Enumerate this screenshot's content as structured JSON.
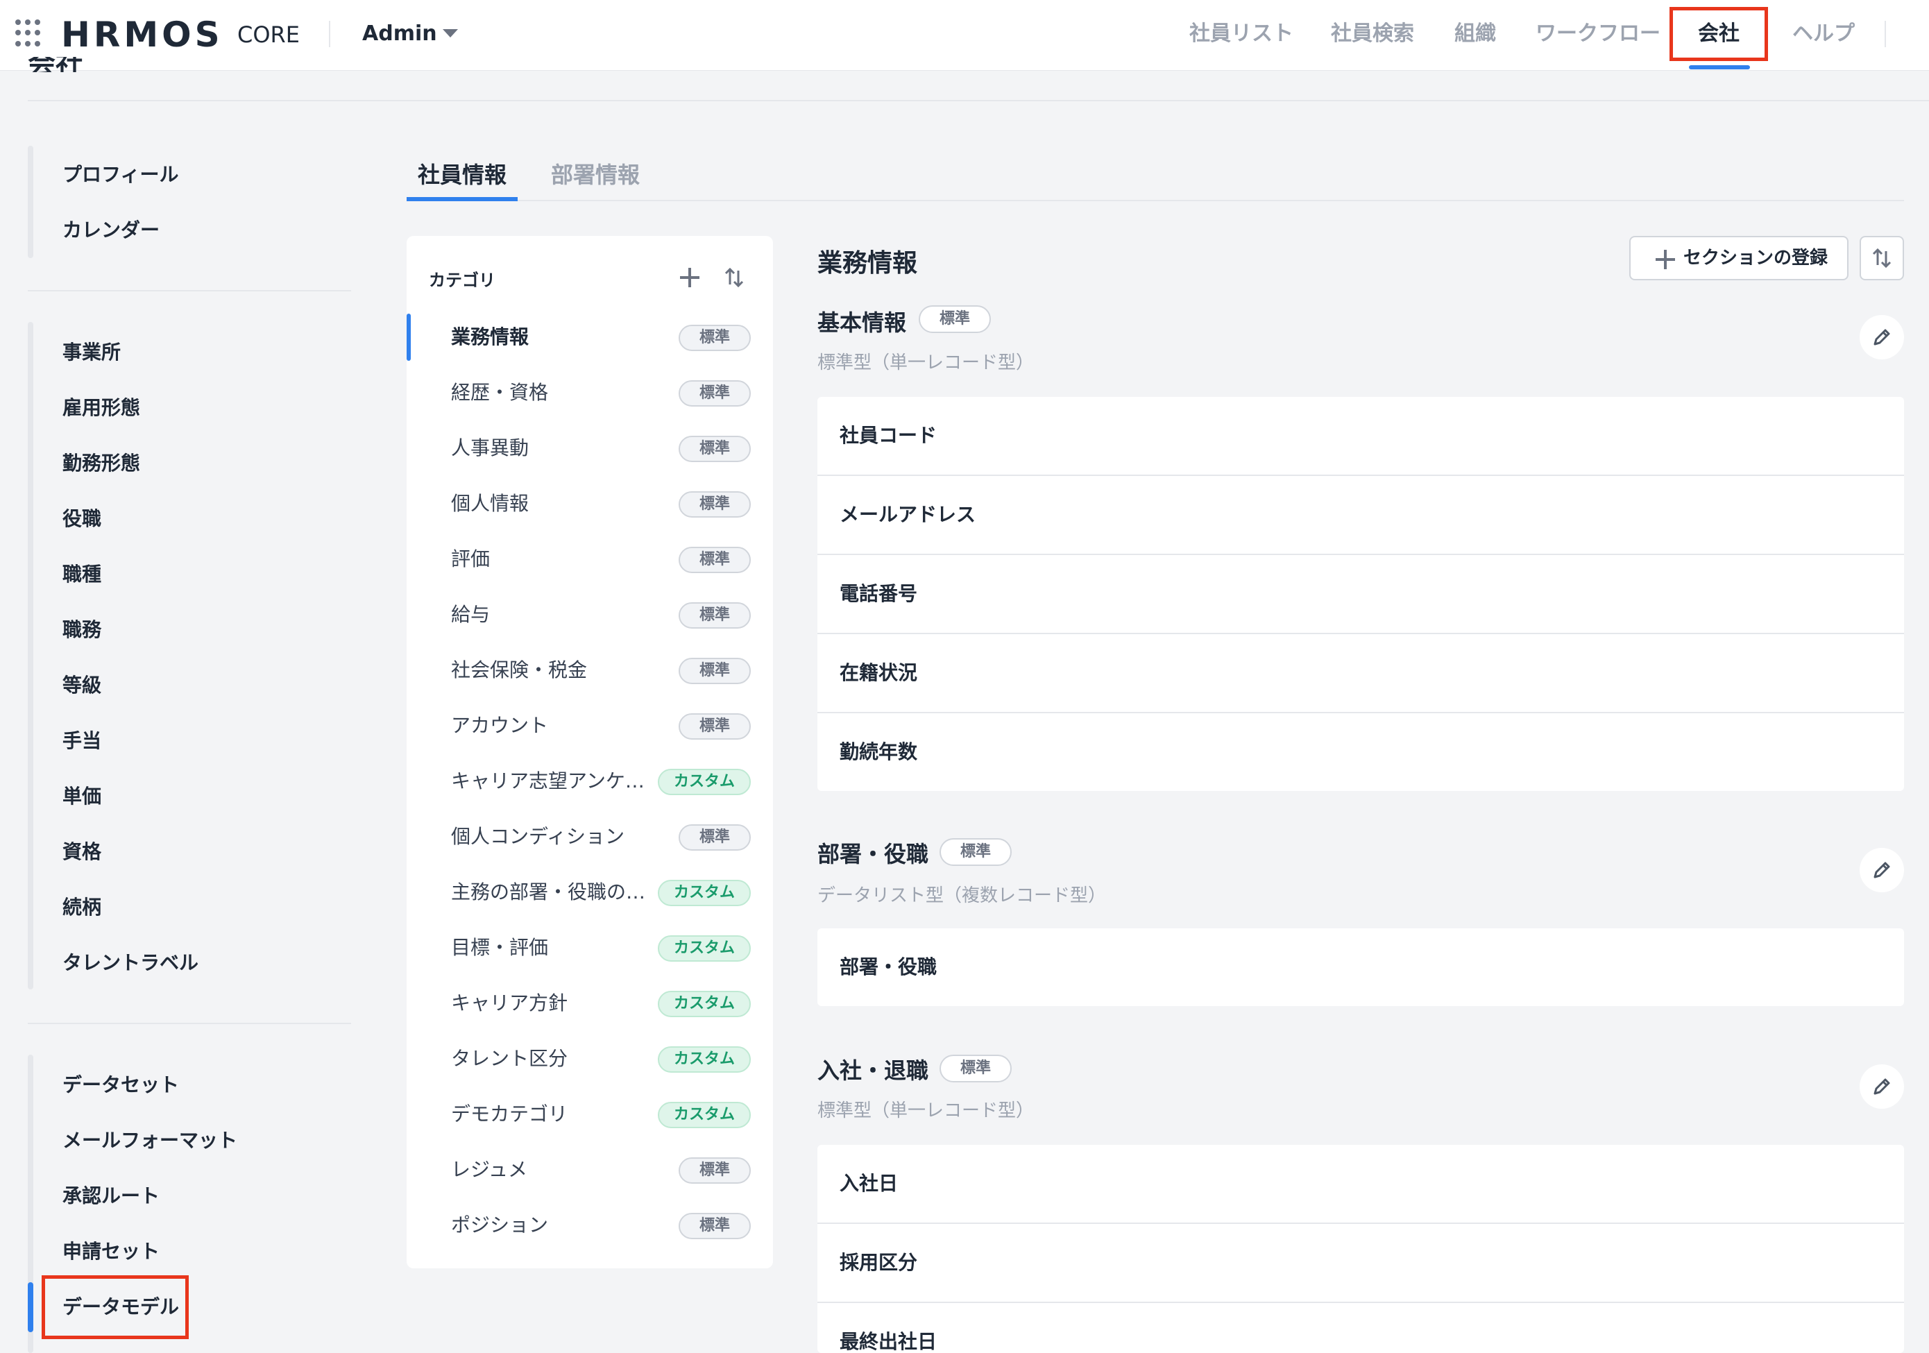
{
  "header": {
    "brand": "HRMOS",
    "brand_sub": "CORE",
    "account": "Admin",
    "nav": [
      "社員リスト",
      "社員検索",
      "組織",
      "ワークフロー",
      "会社",
      "ヘルプ"
    ],
    "active_nav": "会社"
  },
  "page": {
    "title": "会社"
  },
  "sidebar": {
    "group1": [
      "プロフィール",
      "カレンダー"
    ],
    "group2": [
      "事業所",
      "雇用形態",
      "勤務形態",
      "役職",
      "職種",
      "職務",
      "等級",
      "手当",
      "単価",
      "資格",
      "続柄",
      "タレントラベル"
    ],
    "group3": [
      "データセット",
      "メールフォーマット",
      "承認ルート",
      "申請セット",
      "データモデル"
    ],
    "active": "データモデル"
  },
  "tabs": [
    "社員情報",
    "部署情報"
  ],
  "categories": {
    "header": "カテゴリ",
    "items": [
      {
        "label": "業務情報",
        "badge": "標準"
      },
      {
        "label": "経歴・資格",
        "badge": "標準"
      },
      {
        "label": "人事異動",
        "badge": "標準"
      },
      {
        "label": "個人情報",
        "badge": "標準"
      },
      {
        "label": "評価",
        "badge": "標準"
      },
      {
        "label": "給与",
        "badge": "標準"
      },
      {
        "label": "社会保険・税金",
        "badge": "標準"
      },
      {
        "label": "アカウント",
        "badge": "標準"
      },
      {
        "label": "キャリア志望アンケート",
        "badge": "カスタム"
      },
      {
        "label": "個人コンディション",
        "badge": "標準"
      },
      {
        "label": "主務の部署・役職の履歴",
        "badge": "カスタム"
      },
      {
        "label": "目標・評価",
        "badge": "カスタム"
      },
      {
        "label": "キャリア方針",
        "badge": "カスタム"
      },
      {
        "label": "タレント区分",
        "badge": "カスタム"
      },
      {
        "label": "デモカテゴリ",
        "badge": "カスタム"
      },
      {
        "label": "レジュメ",
        "badge": "標準"
      },
      {
        "label": "ポジション",
        "badge": "標準"
      }
    ]
  },
  "detail": {
    "title": "業務情報",
    "add_section_label": "セクションの登録",
    "sections": [
      {
        "title": "基本情報",
        "badge": "標準",
        "type": "標準型（単一レコード型）",
        "fields": [
          "社員コード",
          "メールアドレス",
          "電話番号",
          "在籍状況",
          "勤続年数"
        ]
      },
      {
        "title": "部署・役職",
        "badge": "標準",
        "type": "データリスト型（複数レコード型）",
        "fields": [
          "部署・役職"
        ]
      },
      {
        "title": "入社・退職",
        "badge": "標準",
        "type": "標準型（単一レコード型）",
        "fields": [
          "入社日",
          "採用区分",
          "最終出社日"
        ]
      }
    ]
  },
  "colors": {
    "accent": "#2f80ed",
    "highlight": "#e8361c",
    "custom_badge": "#1a9b6b"
  },
  "icons": [
    "apps-grid-icon",
    "chevron-down-icon",
    "plus-icon",
    "sort-icon",
    "pencil-icon"
  ]
}
